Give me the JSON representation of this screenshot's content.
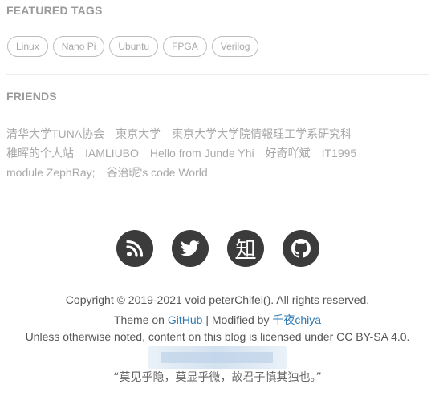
{
  "featured_tags": {
    "title": "FEATURED TAGS",
    "tags": [
      "Linux",
      "Nano Pi",
      "Ubuntu",
      "FPGA",
      "Verilog"
    ]
  },
  "friends": {
    "title": "FRIENDS",
    "rows": [
      [
        "清华大学TUNA协会",
        "東京大学",
        "東京大学大学院情報理工学系研究科"
      ],
      [
        "稚晖的个人站",
        "IAMLIUBO",
        "Hello from Junde Yhi",
        "好奇吖斌",
        "IT1995"
      ],
      [
        "module ZephRay;",
        "谷治昵's code World"
      ]
    ]
  },
  "social": {
    "icons": [
      "rss-icon",
      "twitter-icon",
      "zhihu-icon",
      "github-icon"
    ],
    "zhihu_glyph": "知",
    "button_color": "#3b3b3b"
  },
  "footer": {
    "copyright": "Copyright © 2019-2021 void peterChifei(). All rights reserved.",
    "theme_prefix": "Theme on ",
    "theme_link": "GitHub",
    "modified_prefix": " | Modified by ",
    "modified_link": "千夜chiya",
    "license": "Unless otherwise noted, content on this blog is licensed under CC BY-SA 4.0.",
    "quote": "“莫见乎隐，莫显乎微，故君子慎其独也。”",
    "link_color": "#2c7ab5"
  }
}
